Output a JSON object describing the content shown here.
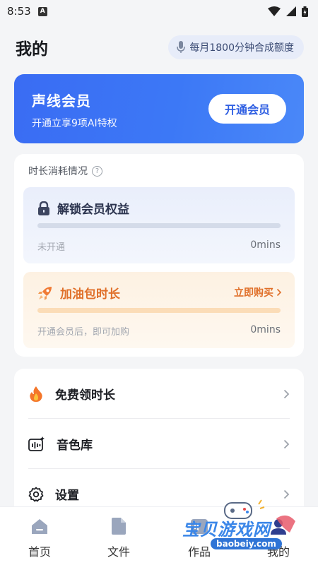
{
  "status_bar": {
    "time": "8:53",
    "app_badge": "A"
  },
  "header": {
    "title": "我的",
    "quota_label": "每月1800分钟合成额度"
  },
  "membership": {
    "title": "声线会员",
    "subtitle": "开通立享9项AI特权",
    "button_label": "开通会员"
  },
  "usage": {
    "title": "时长消耗情况",
    "unlock": {
      "label": "解锁会员权益",
      "status": "未开通",
      "amount": "0mins",
      "progress": 0
    },
    "fuel_pack": {
      "label": "加油包时长",
      "action_label": "立即购买",
      "note": "开通会员后，即可加购",
      "amount": "0mins",
      "progress": 0
    }
  },
  "menu": [
    {
      "label": "免费领时长",
      "icon": "flame-icon"
    },
    {
      "label": "音色库",
      "icon": "voice-library-icon"
    },
    {
      "label": "设置",
      "icon": "gear-icon"
    }
  ],
  "tabs": [
    {
      "label": "首页",
      "icon": "home-icon"
    },
    {
      "label": "文件",
      "icon": "file-icon"
    },
    {
      "label": "作品",
      "icon": "works-icon"
    },
    {
      "label": "我的",
      "icon": "profile-icon"
    }
  ],
  "watermark": {
    "text": "宝贝游戏网",
    "url": "baobeiy.com"
  },
  "colors": {
    "accent": "#3a6cf3",
    "orange": "#e0702a",
    "background": "#f4f5f7"
  }
}
